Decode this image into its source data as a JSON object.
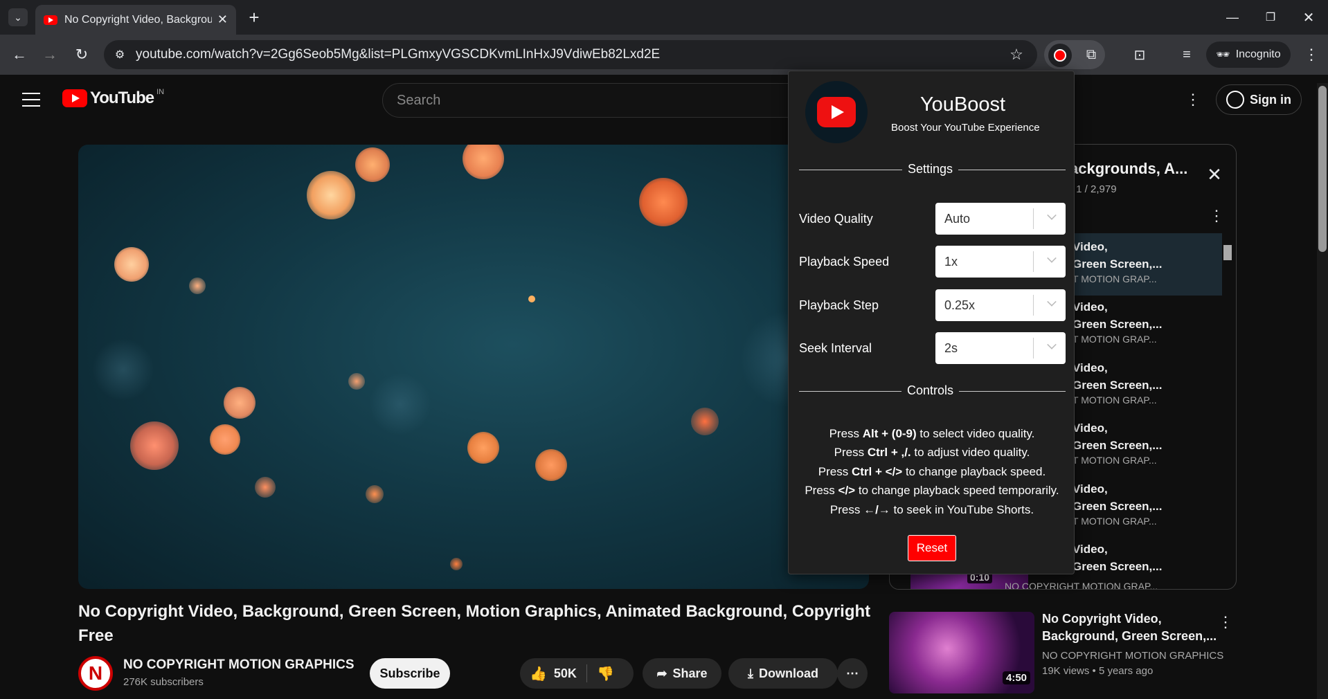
{
  "browser": {
    "tab_title": "No Copyright Video, Backgroun",
    "url": "youtube.com/watch?v=2Gg6Seob5Mg&list=PLGmxyVGSCDKvmLInHxJ9VdiwEb82Lxd2E",
    "incognito_label": "Incognito"
  },
  "youtube": {
    "logo_text": "YouTube",
    "region": "IN",
    "search_placeholder": "Search",
    "sign_in": "Sign in"
  },
  "video": {
    "title": "No Copyright Video, Background, Green Screen, Motion Graphics, Animated Background, Copyright Free",
    "channel": "NO COPYRIGHT MOTION GRAPHICS",
    "subscribers": "276K subscribers",
    "subscribe": "Subscribe",
    "likes": "50K",
    "share": "Share",
    "download": "Download"
  },
  "playlist": {
    "title": "ackgrounds, A...",
    "position": "- 1 / 2,979",
    "items": [
      {
        "line1": "Video,",
        "line2": "Green Screen,...",
        "channel": "T MOTION GRAP..."
      },
      {
        "line1": "Video,",
        "line2": "Green Screen,...",
        "channel": "T MOTION GRAP..."
      },
      {
        "line1": "Video,",
        "line2": "Green Screen,...",
        "channel": "T MOTION GRAP..."
      },
      {
        "line1": "Video,",
        "line2": "Green Screen,...",
        "channel": "T MOTION GRAP..."
      },
      {
        "line1": "Video,",
        "line2": "Green Screen,...",
        "channel": "T MOTION GRAP..."
      },
      {
        "line1": "Video,",
        "line2": "Green Screen,...",
        "channel": "NO COPYRIGHT MOTION GRAP..."
      }
    ],
    "last_duration": "0:10"
  },
  "recommendation": {
    "title_line1": "No Copyright Video,",
    "title_line2": "Background, Green Screen,...",
    "channel": "NO COPYRIGHT MOTION GRAPHICS",
    "meta": "19K views  •  5 years ago",
    "duration": "4:50"
  },
  "popup": {
    "name": "YouBoost",
    "tagline": "Boost Your YouTube Experience",
    "settings_heading": "Settings",
    "settings": [
      {
        "label": "Video Quality",
        "value": "Auto"
      },
      {
        "label": "Playback Speed",
        "value": "1x"
      },
      {
        "label": "Playback Step",
        "value": "0.25x"
      },
      {
        "label": "Seek Interval",
        "value": "2s"
      }
    ],
    "controls_heading": "Controls",
    "controls": [
      {
        "pre": "Press ",
        "key": "Alt + (0-9)",
        "post": " to select video quality."
      },
      {
        "pre": "Press ",
        "key": "Ctrl + ,/.",
        "post": " to adjust video quality."
      },
      {
        "pre": "Press ",
        "key": "Ctrl + </>",
        "post": " to change playback speed."
      },
      {
        "pre": "Press ",
        "key": "</>",
        "post": " to change playback speed temporarily."
      },
      {
        "pre": "Press ",
        "key": "←/→",
        "post": " to seek in YouTube Shorts."
      }
    ],
    "reset": "Reset"
  },
  "colors": {
    "accent": "#ff0000",
    "popup_bg": "#1f1f1f",
    "page_bg": "#0f0f0f"
  }
}
